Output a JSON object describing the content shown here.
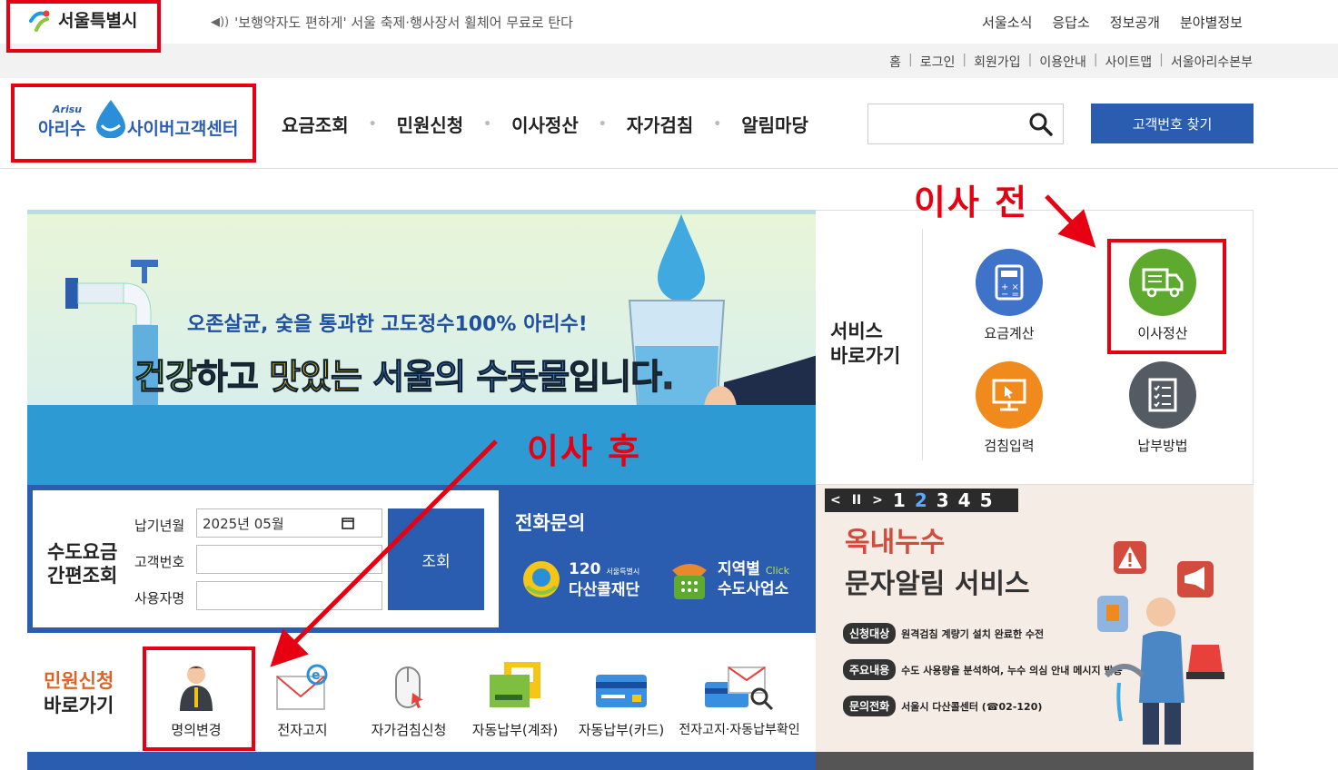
{
  "topbar": {
    "seoul_logo_text": "서울특별시",
    "notice": "'보행약자도 편하게' 서울 축제·행사장서 휠체어 무료로 탄다",
    "links": [
      "서울소식",
      "응답소",
      "정보공개",
      "분야별정보"
    ]
  },
  "util_links": [
    "홈",
    "로그인",
    "회원가입",
    "이용안내",
    "사이트맵",
    "서울아리수본부"
  ],
  "header": {
    "logo_small": "Arisu",
    "logo_brand": "아리수",
    "logo_title": "사이버고객센터",
    "nav": [
      "요금조회",
      "민원신청",
      "이사정산",
      "자가검침",
      "알림마당"
    ],
    "search_placeholder": "",
    "find_button": "고객번호 찾기"
  },
  "annotations": {
    "before": "이사 전",
    "after": "이사 후"
  },
  "banner": {
    "line1": "오존살균, 숯을 통과한 고도정수100% 아리수!",
    "line2_parts": [
      "건강",
      "하고 ",
      "맛있는",
      " 서울의 ",
      "수돗물",
      "입니다."
    ]
  },
  "service": {
    "title_line1": "서비스",
    "title_line2": "바로가기",
    "items": [
      {
        "label": "요금계산",
        "color": "#3e73c9"
      },
      {
        "label": "이사정산",
        "color": "#5eaa2f"
      },
      {
        "label": "검침입력",
        "color": "#f08a1d"
      },
      {
        "label": "납부방법",
        "color": "#555b63"
      }
    ]
  },
  "quick": {
    "title_line1": "수도요금",
    "title_line2": "간편조회",
    "label_month": "납기년월",
    "label_customer": "고객번호",
    "label_user": "사용자명",
    "month_value": "2025년 05월",
    "submit": "조회",
    "phone_title": "전화문의",
    "phone1_num": "120",
    "phone1_small": "서울특별시",
    "phone1_name": "다산콜재단",
    "phone2_line1": "지역별",
    "phone2_click": "Click",
    "phone2_line2": "수도사업소"
  },
  "civil": {
    "title_line1": "민원신청",
    "title_line2": "바로가기",
    "items": [
      "명의변경",
      "전자고지",
      "자가검침신청",
      "자동납부(계좌)",
      "자동납부(카드)",
      "전자고지·자동납부확인"
    ]
  },
  "promo": {
    "pager_numbers": [
      "1",
      "2",
      "3",
      "4",
      "5"
    ],
    "active_page": "2",
    "title1": "옥내누수",
    "title2": "문자알림 서비스",
    "rows": [
      {
        "tag": "신청대상",
        "text": "원격검침 계량기 설치 완료한 수전"
      },
      {
        "tag": "주요내용",
        "text": "수도 사용량을 분석하여, 누수 의심 안내 메시지 발송"
      },
      {
        "tag": "문의전화",
        "text": "서울시 다산콜센터 (☎02-120)"
      }
    ]
  }
}
